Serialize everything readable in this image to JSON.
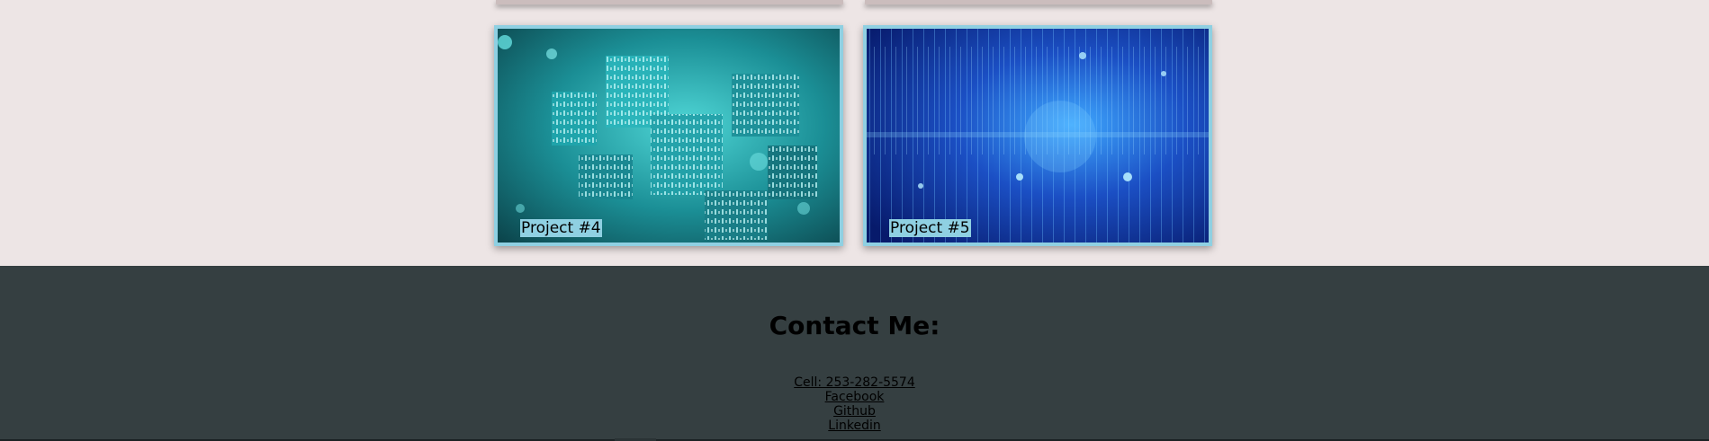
{
  "projects": [
    {
      "label": "Project #4",
      "image": "cyber-data-cubes-image"
    },
    {
      "label": "Project #5",
      "image": "blue-circuit-binary-image"
    }
  ],
  "footer": {
    "title": "Contact Me:",
    "links": [
      {
        "label": "Cell: 253-282-5574"
      },
      {
        "label": "Facebook"
      },
      {
        "label": "Github"
      },
      {
        "label": "Linkedin"
      }
    ]
  },
  "colors": {
    "page_background": "#ede5e5",
    "card_border": "#8fd0e2",
    "footer_background": "#353f41"
  }
}
